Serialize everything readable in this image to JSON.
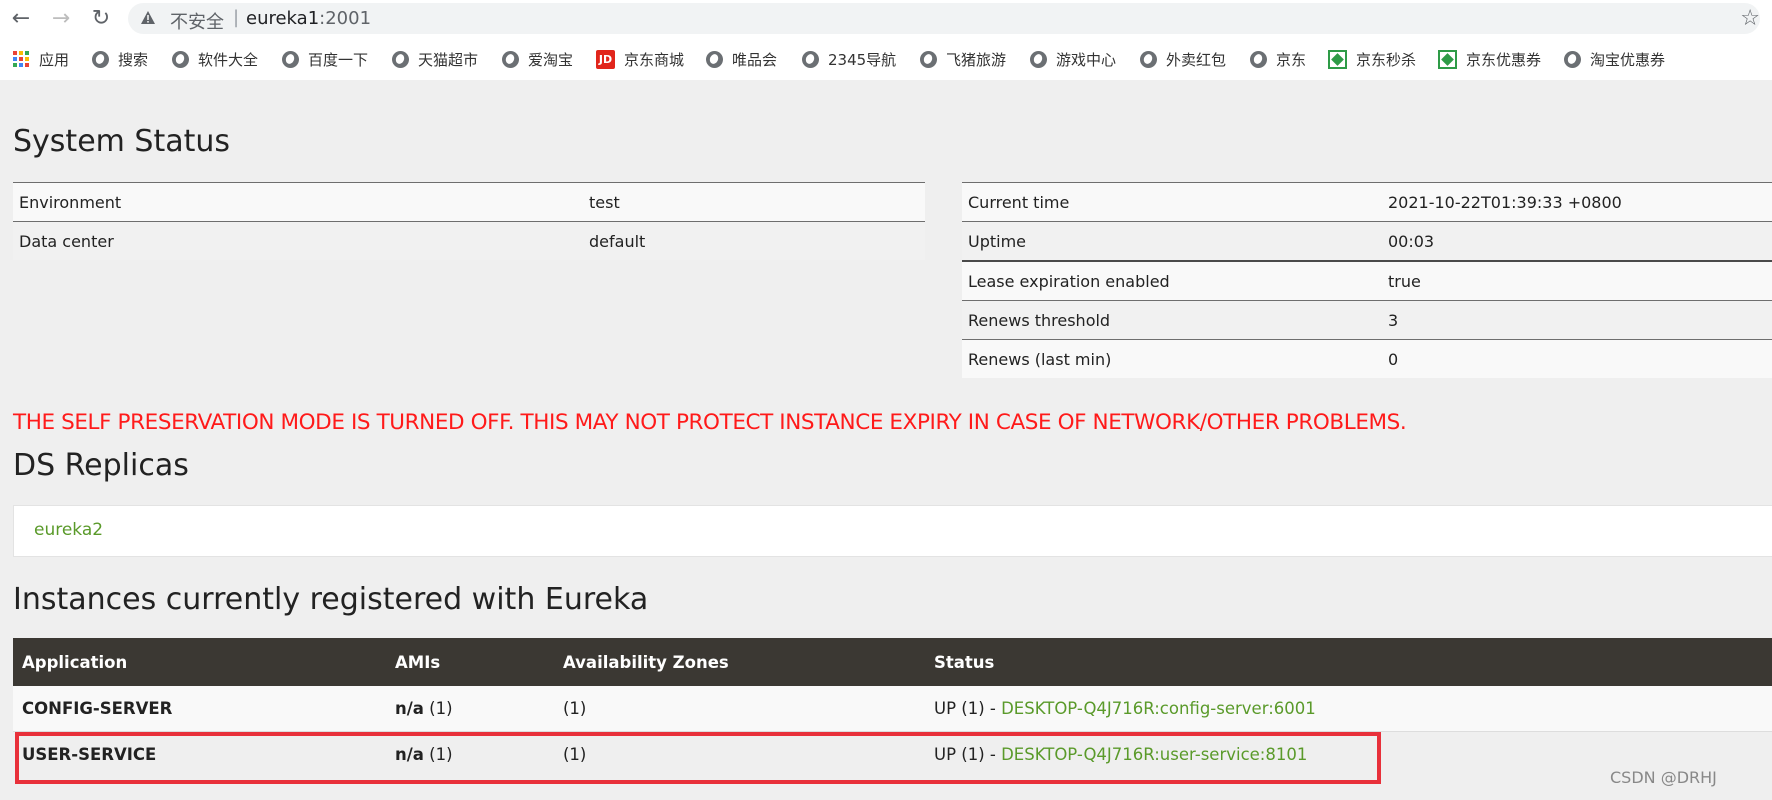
{
  "browser": {
    "insecure_label": "不安全",
    "url_sep": "|",
    "url_host": "eureka1",
    "url_port": ":2001",
    "bookmarks": [
      {
        "label": "应用",
        "icon": "apps-grid-icon"
      },
      {
        "label": "搜索",
        "icon": "globe-icon"
      },
      {
        "label": "软件大全",
        "icon": "globe-icon"
      },
      {
        "label": "百度一下",
        "icon": "globe-icon"
      },
      {
        "label": "天猫超市",
        "icon": "globe-icon"
      },
      {
        "label": "爱淘宝",
        "icon": "globe-icon"
      },
      {
        "label": "京东商城",
        "icon": "jd-icon"
      },
      {
        "label": "唯品会",
        "icon": "globe-icon"
      },
      {
        "label": "2345导航",
        "icon": "globe-icon"
      },
      {
        "label": "飞猪旅游",
        "icon": "globe-icon"
      },
      {
        "label": "游戏中心",
        "icon": "globe-icon"
      },
      {
        "label": "外卖红包",
        "icon": "globe-icon"
      },
      {
        "label": "京东",
        "icon": "globe-icon"
      },
      {
        "label": "京东秒杀",
        "icon": "green-square-icon"
      },
      {
        "label": "京东优惠券",
        "icon": "green-square-icon"
      },
      {
        "label": "淘宝优惠券",
        "icon": "globe-icon"
      }
    ]
  },
  "system_status": {
    "title": "System Status",
    "left_rows": [
      {
        "key": "Environment",
        "value": "test"
      },
      {
        "key": "Data center",
        "value": "default"
      }
    ],
    "right_rows": [
      {
        "key": "Current time",
        "value": "2021-10-22T01:39:33 +0800"
      },
      {
        "key": "Uptime",
        "value": "00:03"
      },
      {
        "key": "Lease expiration enabled",
        "value": "true"
      },
      {
        "key": "Renews threshold",
        "value": "3"
      },
      {
        "key": "Renews (last min)",
        "value": "0"
      }
    ]
  },
  "warning": "THE SELF PRESERVATION MODE IS TURNED OFF. THIS MAY NOT PROTECT INSTANCE EXPIRY IN CASE OF NETWORK/OTHER PROBLEMS.",
  "replicas": {
    "title": "DS Replicas",
    "items": [
      "eureka2"
    ]
  },
  "instances": {
    "title": "Instances currently registered with Eureka",
    "headers": [
      "Application",
      "AMIs",
      "Availability Zones",
      "Status"
    ],
    "rows": [
      {
        "app": "CONFIG-SERVER",
        "amis_strong": "n/a",
        "amis_count": "(1)",
        "zones": "(1)",
        "status_prefix": "UP (1) - ",
        "instance_link": "DESKTOP-Q4J716R:config-server:6001"
      },
      {
        "app": "USER-SERVICE",
        "amis_strong": "n/a",
        "amis_count": "(1)",
        "zones": "(1)",
        "status_prefix": "UP (1) - ",
        "instance_link": "DESKTOP-Q4J716R:user-service:8101"
      }
    ]
  },
  "watermark": "CSDN @DRHJ",
  "colors": {
    "warning": "#ff1a1a",
    "link": "#5a9a2a",
    "table_header": "#3b3833",
    "highlight": "#e8303a"
  }
}
